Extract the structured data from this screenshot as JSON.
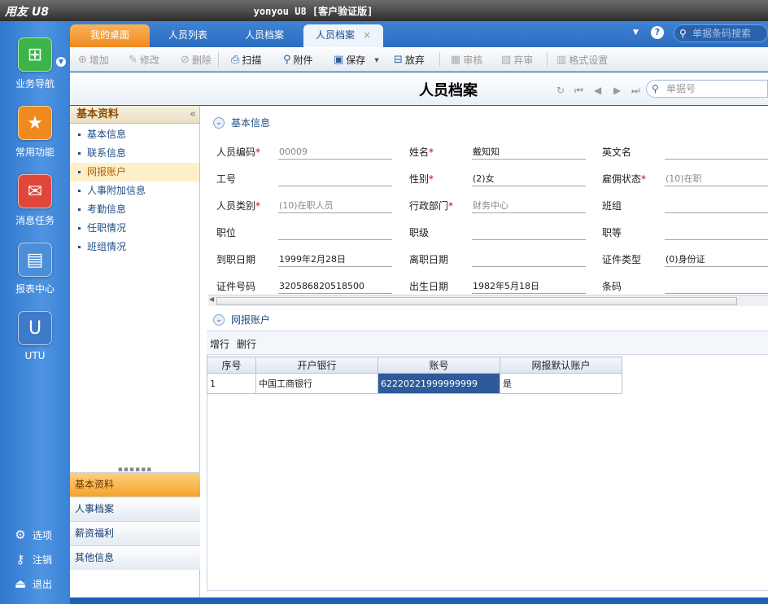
{
  "window": {
    "logo": "用友 U8",
    "title": "yonyou U8 [客户验证版]"
  },
  "leftnav": {
    "items": [
      {
        "label": "业务导航",
        "icon": "business-nav-icon",
        "glyph": "⊞",
        "color": "#3cb44a"
      },
      {
        "label": "常用功能",
        "icon": "star-icon",
        "glyph": "★",
        "color": "#f08a1f"
      },
      {
        "label": "消息任务",
        "icon": "mail-icon",
        "glyph": "✉",
        "color": "#e0463a"
      },
      {
        "label": "报表中心",
        "icon": "report-icon",
        "glyph": "▤",
        "color": "#4a8fd8"
      },
      {
        "label": "UTU",
        "icon": "utu-icon",
        "glyph": "U",
        "color": "#3d7bc9"
      }
    ],
    "links": [
      {
        "label": "选项",
        "icon": "gear-icon",
        "glyph": "⚙"
      },
      {
        "label": "注销",
        "icon": "key-icon",
        "glyph": "⚷"
      },
      {
        "label": "退出",
        "icon": "exit-icon",
        "glyph": "⏏"
      }
    ]
  },
  "tabs": {
    "items": [
      "我的桌面",
      "人员列表",
      "人员档案",
      "人员档案"
    ],
    "close": "×",
    "search_placeholder": "单据条码搜索",
    "help": "?"
  },
  "toolbar": {
    "items": [
      {
        "label": "增加",
        "icon": "add-icon",
        "glyph": "⊕",
        "enabled": false
      },
      {
        "label": "修改",
        "icon": "edit-icon",
        "glyph": "✎",
        "enabled": false
      },
      {
        "label": "删除",
        "icon": "delete-icon",
        "glyph": "⊘",
        "enabled": false
      },
      {
        "label": "扫描",
        "icon": "scan-icon",
        "glyph": "⎙",
        "enabled": true
      },
      {
        "label": "附件",
        "icon": "attachment-icon",
        "glyph": "⚲",
        "enabled": true
      },
      {
        "label": "保存",
        "icon": "save-icon",
        "glyph": "▣",
        "enabled": true
      },
      {
        "label": "放弃",
        "icon": "discard-icon",
        "glyph": "⊟",
        "enabled": true
      },
      {
        "label": "审核",
        "icon": "approve-icon",
        "glyph": "▦",
        "enabled": false
      },
      {
        "label": "弃审",
        "icon": "unapprove-icon",
        "glyph": "▧",
        "enabled": false
      },
      {
        "label": "格式设置",
        "icon": "format-icon",
        "glyph": "▥",
        "enabled": false
      }
    ],
    "save_dropdown": "▼"
  },
  "page": {
    "title": "人员档案",
    "doc_search_placeholder": "单据号"
  },
  "leftpanel": {
    "header": "基本资料",
    "collapse": "«",
    "items": [
      "基本信息",
      "联系信息",
      "网报账户",
      "人事附加信息",
      "考勤信息",
      "任职情况",
      "班组情况"
    ],
    "selected_index": 2,
    "grip": "▪▪▪▪▪▪",
    "bottom": [
      "基本资料",
      "人事档案",
      "薪资福利",
      "其他信息"
    ],
    "bottom_selected": 0
  },
  "basic": {
    "section_title": "基本信息",
    "fields": [
      {
        "label": "人员编码",
        "required": true,
        "value": "00009",
        "gray": true
      },
      {
        "label": "姓名",
        "required": true,
        "value": "戴知知",
        "gray": false
      },
      {
        "label": "英文名",
        "required": false,
        "value": "",
        "gray": false
      },
      {
        "label": "工号",
        "required": false,
        "value": "",
        "gray": false
      },
      {
        "label": "性别",
        "required": true,
        "value": "(2)女",
        "gray": false
      },
      {
        "label": "雇佣状态",
        "required": true,
        "value": "(10)在职",
        "gray": true
      },
      {
        "label": "人员类别",
        "required": true,
        "value": "(10)在职人员",
        "gray": true
      },
      {
        "label": "行政部门",
        "required": true,
        "value": "财务中心",
        "gray": true
      },
      {
        "label": "班组",
        "required": false,
        "value": "",
        "gray": false
      },
      {
        "label": "职位",
        "required": false,
        "value": "",
        "gray": false
      },
      {
        "label": "职级",
        "required": false,
        "value": "",
        "gray": false
      },
      {
        "label": "职等",
        "required": false,
        "value": "",
        "gray": false
      },
      {
        "label": "到职日期",
        "required": false,
        "value": "1999年2月28日",
        "gray": false
      },
      {
        "label": "离职日期",
        "required": false,
        "value": "",
        "gray": false
      },
      {
        "label": "证件类型",
        "required": false,
        "value": "(0)身份证",
        "gray": false
      },
      {
        "label": "证件号码",
        "required": false,
        "value": "320586820518500",
        "gray": false
      },
      {
        "label": "出生日期",
        "required": false,
        "value": "1982年5月18日",
        "gray": false
      },
      {
        "label": "条码",
        "required": false,
        "value": "",
        "gray": false
      }
    ]
  },
  "account": {
    "section_title": "网报账户",
    "add_row": "增行",
    "delete_row": "删行",
    "columns": [
      "序号",
      "开户银行",
      "账号",
      "网报默认账户"
    ],
    "rows": [
      [
        "1",
        "中国工商银行",
        "62220221999999999",
        "是"
      ]
    ]
  }
}
